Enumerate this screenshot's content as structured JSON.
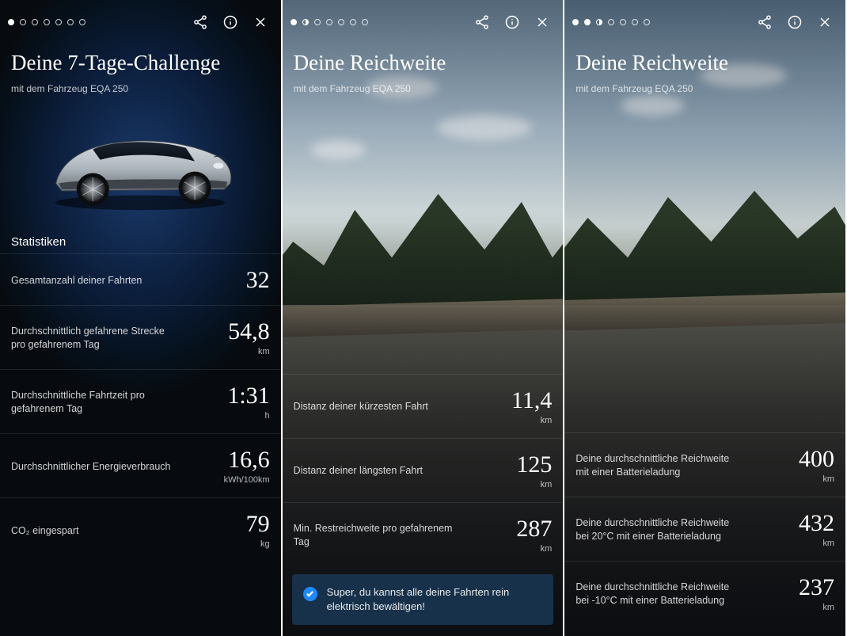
{
  "panels": [
    {
      "pageIndex": 0,
      "title": "Deine 7-Tage-Challenge",
      "subtitle": "mit dem Fahrzeug EQA 250",
      "sectionTitle": "Statistiken",
      "stats": [
        {
          "label": "Gesamtanzahl deiner Fahrten",
          "value": "32",
          "unit": ""
        },
        {
          "label": "Durchschnittlich gefahrene Strecke pro gefahrenem Tag",
          "value": "54,8",
          "unit": "km"
        },
        {
          "label": "Durchschnittliche Fahrtzeit pro gefahrenem Tag",
          "value": "1:31",
          "unit": "h"
        },
        {
          "label": "Durchschnittlicher Energieverbrauch",
          "value": "16,6",
          "unit": "kWh/100km"
        },
        {
          "label": "CO₂ eingespart",
          "value": "79",
          "unit": "kg"
        }
      ]
    },
    {
      "pageIndex": 1,
      "title": "Deine Reichweite",
      "subtitle": "mit dem Fahrzeug EQA 250",
      "stats": [
        {
          "label": "Distanz deiner kürzesten Fahrt",
          "value": "11,4",
          "unit": "km"
        },
        {
          "label": "Distanz deiner längsten Fahrt",
          "value": "125",
          "unit": "km"
        },
        {
          "label": "Min. Restreichweite pro gefahrenem Tag",
          "value": "287",
          "unit": "km"
        }
      ],
      "banner": "Super, du kannst alle deine Fahrten rein elektrisch bewältigen!"
    },
    {
      "pageIndex": 2,
      "title": "Deine Reichweite",
      "subtitle": "mit dem Fahrzeug EQA 250",
      "stats": [
        {
          "label": "Deine durchschnittliche Reichweite mit einer Batterieladung",
          "value": "400",
          "unit": "km"
        },
        {
          "label": "Deine durchschnittliche Reichweite bei 20°C mit einer Batterieladung",
          "value": "432",
          "unit": "km"
        },
        {
          "label": "Deine durchschnittliche Reichweite bei -10°C mit einer Batterieladung",
          "value": "237",
          "unit": "km"
        }
      ]
    }
  ],
  "pager": {
    "total": 7
  },
  "icons": {
    "share": "share-icon",
    "info": "info-icon",
    "close": "close-icon"
  }
}
